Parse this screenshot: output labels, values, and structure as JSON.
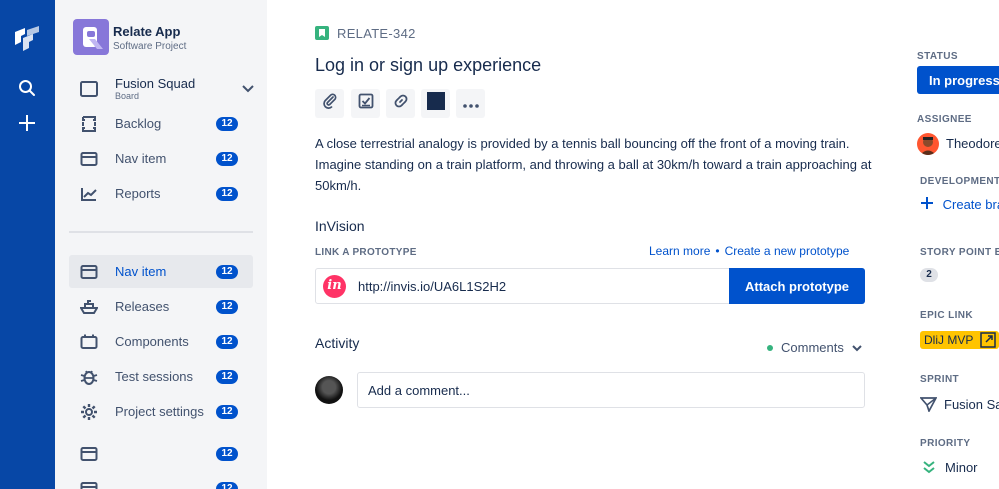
{
  "project": {
    "name": "Relate App",
    "type": "Software Project"
  },
  "board": {
    "name": "Fusion Squad",
    "subtitle": "Board"
  },
  "sidebar": {
    "top_items": [
      {
        "label": "Backlog",
        "count": "12",
        "icon": "backlog-icon"
      },
      {
        "label": "Nav item",
        "count": "12",
        "icon": "window-icon"
      },
      {
        "label": "Reports",
        "count": "12",
        "icon": "chart-icon"
      }
    ],
    "bottom_items": [
      {
        "label": "Nav item",
        "count": "12",
        "icon": "window-icon",
        "active": true
      },
      {
        "label": "Releases",
        "count": "12",
        "icon": "ship-icon"
      },
      {
        "label": "Components",
        "count": "12",
        "icon": "calendar-icon"
      },
      {
        "label": "Test sessions",
        "count": "12",
        "icon": "bug-icon"
      },
      {
        "label": "Project settings",
        "count": "12",
        "icon": "gear-icon"
      },
      {
        "label": "",
        "count": "12",
        "icon": "window-icon"
      },
      {
        "label": "",
        "count": "12",
        "icon": "window-icon"
      }
    ]
  },
  "issue": {
    "key": "RELATE-342",
    "title": "Log in or sign up experience",
    "description": "A close terrestrial analogy is provided by a tennis ball bouncing off the front of a moving train. Imagine standing on a train platform, and throwing a ball at 30km/h toward a train approaching at 50km/h."
  },
  "toolbar": {
    "buttons": [
      "attachment-icon",
      "checklist-icon",
      "link-icon",
      "square-icon",
      "more-icon"
    ]
  },
  "invision": {
    "title": "InVision",
    "link_label": "LINK A PROTOTYPE",
    "learn_more": "Learn more",
    "separator": "•",
    "create_prototype": "Create a new prototype",
    "input_value": "http://invis.io/UA6L1S2H2",
    "logo_text": "in",
    "attach_label": "Attach prototype"
  },
  "activity": {
    "title": "Activity",
    "filter_label": "Comments",
    "comment_placeholder": "Add a comment..."
  },
  "details": {
    "status_label": "STATUS",
    "status_value": "In progress",
    "assignee_label": "ASSIGNEE",
    "assignee_name": "Theodore",
    "development_label": "DEVELOPMENT",
    "create_branch": "Create bra",
    "story_points_label": "STORY POINT ES",
    "story_points": "2",
    "epic_label": "EPIC LINK",
    "epic_value": "DliJ MVP",
    "sprint_label": "SPRINT",
    "sprint_value": "Fusion Sa",
    "priority_label": "PRIORITY",
    "priority_value": "Minor"
  },
  "colors": {
    "global_nav": "#0747a6",
    "primary": "#0052cc",
    "sidebar_bg": "#f4f5f7",
    "success": "#36b37e",
    "epic": "#ffc400",
    "invision": "#ff3366"
  }
}
